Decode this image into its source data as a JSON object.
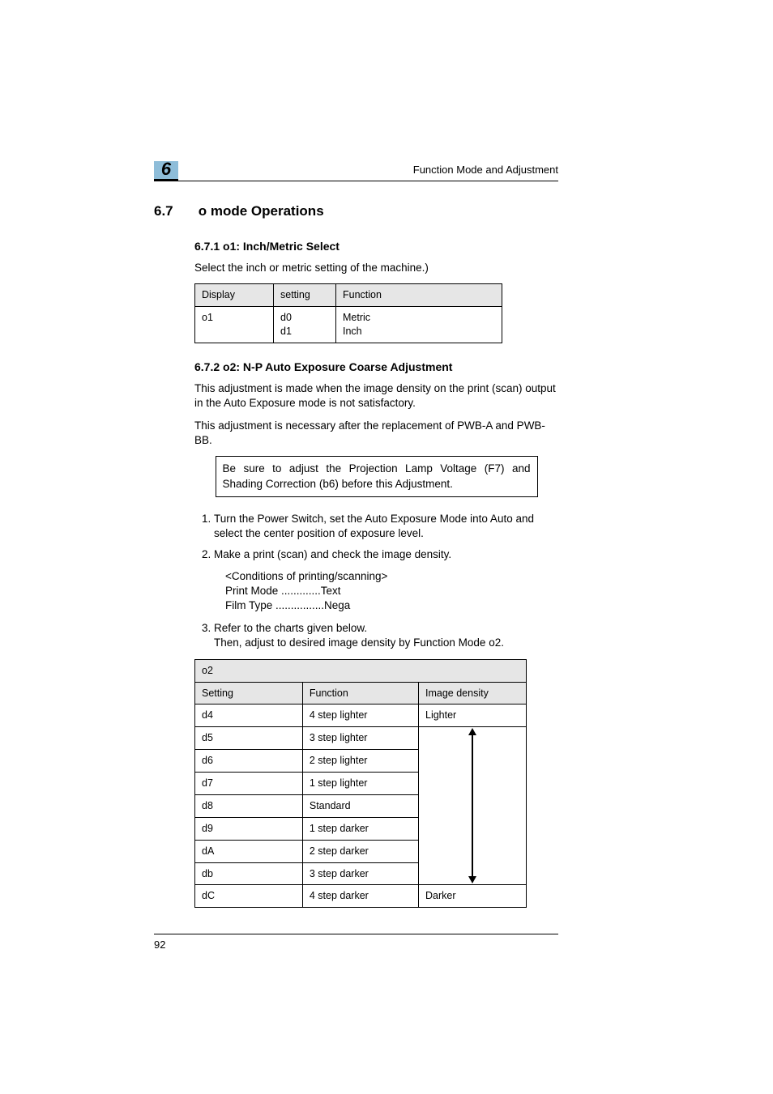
{
  "chapter_number": "6",
  "running_title": "Function Mode and Adjustment",
  "section": {
    "number": "6.7",
    "title": "o mode Operations"
  },
  "sub_671": {
    "heading": "6.7.1   o1: Inch/Metric Select",
    "intro": "Select the inch or metric setting of the machine.)",
    "table": {
      "headers": {
        "c1": "Display",
        "c2": "setting",
        "c3": "Function"
      },
      "row": {
        "display": "o1",
        "setting_line1": "d0",
        "setting_line2": "d1",
        "func_line1": "Metric",
        "func_line2": "Inch"
      }
    }
  },
  "sub_672": {
    "heading": "6.7.2   o2: N-P Auto Exposure Coarse Adjustment",
    "para1": "This adjustment is made when the image density on the print (scan) output in the Auto Exposure mode is not satisfactory.",
    "para2": "This adjustment is necessary after the replacement of PWB-A and PWB-BB.",
    "note": "Be sure to adjust the Projection Lamp Voltage (F7) and Shading Correction (b6) before this Adjustment.",
    "steps": {
      "s1": "Turn the Power Switch, set the Auto Exposure Mode into Auto and select the center position of exposure level.",
      "s2": "Make a print (scan) and check the image density.",
      "s2_sub_l1": "<Conditions of printing/scanning>",
      "s2_sub_l2": "Print Mode .............Text",
      "s2_sub_l3": "Film Type ................Nega",
      "s3_l1": "Refer to the charts given below.",
      "s3_l2": "Then, adjust to desired image density by Function Mode o2."
    },
    "o2_table": {
      "title": "o2",
      "headers": {
        "setting": "Setting",
        "function": "Function",
        "density": "Image density"
      },
      "top_label": "Lighter",
      "bottom_label": "Darker",
      "rows": [
        {
          "setting": "d4",
          "function": "4 step lighter"
        },
        {
          "setting": "d5",
          "function": "3 step lighter"
        },
        {
          "setting": "d6",
          "function": "2 step lighter"
        },
        {
          "setting": "d7",
          "function": "1 step lighter"
        },
        {
          "setting": "d8",
          "function": "Standard"
        },
        {
          "setting": "d9",
          "function": "1 step darker"
        },
        {
          "setting": "dA",
          "function": "2 step darker"
        },
        {
          "setting": "db",
          "function": "3 step darker"
        },
        {
          "setting": "dC",
          "function": "4 step darker"
        }
      ]
    }
  },
  "page_number": "92"
}
